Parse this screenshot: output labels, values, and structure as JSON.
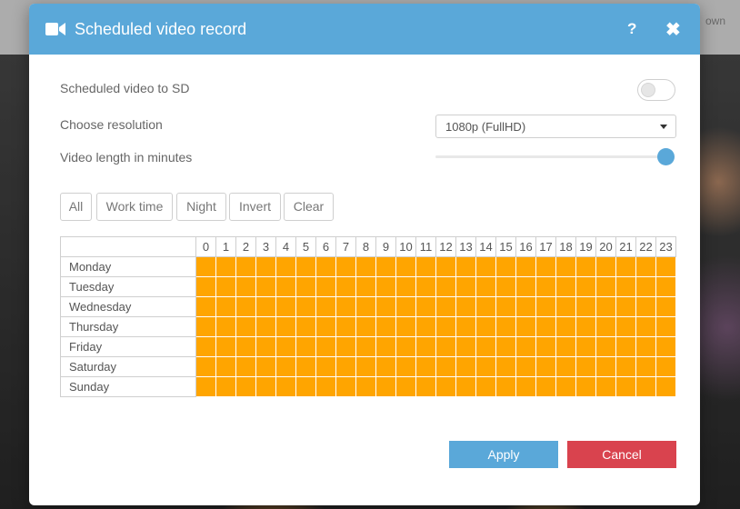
{
  "background": {
    "header_text": "own"
  },
  "dialog": {
    "title": "Scheduled video record",
    "help_label": "?",
    "close_label": "✖",
    "video_sd_label": "Scheduled video to SD",
    "video_sd_enabled": false,
    "resolution_label": "Choose resolution",
    "resolution_value": "1080p (FullHD)",
    "length_label": "Video length in minutes",
    "length_slider_fraction": 1.0,
    "quick_buttons": [
      "All",
      "Work time",
      "Night",
      "Invert",
      "Clear"
    ],
    "hours": [
      "0",
      "1",
      "2",
      "3",
      "4",
      "5",
      "6",
      "7",
      "8",
      "9",
      "10",
      "11",
      "12",
      "13",
      "14",
      "15",
      "16",
      "17",
      "18",
      "19",
      "20",
      "21",
      "22",
      "23"
    ],
    "days": [
      "Monday",
      "Tuesday",
      "Wednesday",
      "Thursday",
      "Friday",
      "Saturday",
      "Sunday"
    ],
    "schedule_all_selected": true,
    "apply_label": "Apply",
    "cancel_label": "Cancel"
  },
  "colors": {
    "header": "#5aa8d9",
    "selected_slot": "#ffa500",
    "apply": "#5aa8d9",
    "cancel": "#d9434e"
  }
}
